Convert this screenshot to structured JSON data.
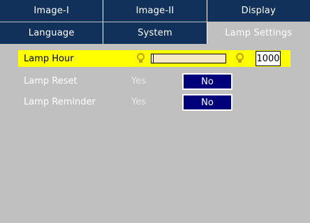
{
  "tabs": {
    "row1": [
      {
        "label": "Image-I"
      },
      {
        "label": "Image-II"
      },
      {
        "label": "Display"
      }
    ],
    "row2": [
      {
        "label": "Language"
      },
      {
        "label": "System"
      },
      {
        "label": "Lamp Settings"
      }
    ]
  },
  "settings": {
    "lamp_hour": {
      "label": "Lamp Hour",
      "value": "1000",
      "slider_fraction": 0.03
    },
    "lamp_reset": {
      "label": "Lamp Reset",
      "option_yes": "Yes",
      "option_no": "No",
      "selected": "No"
    },
    "lamp_reminder": {
      "label": "Lamp Reminder",
      "option_yes": "Yes",
      "option_no": "No",
      "selected": "No"
    }
  },
  "colors": {
    "tab_bg": "#12315a",
    "highlight": "#ffff00",
    "selected_option": "#00007a",
    "panel_bg": "#c0c0c0",
    "bulb_icon": "#c8a000"
  },
  "icons": {
    "lamp_low": "lamp-bulb-icon",
    "lamp_high": "lamp-bulb-icon"
  }
}
